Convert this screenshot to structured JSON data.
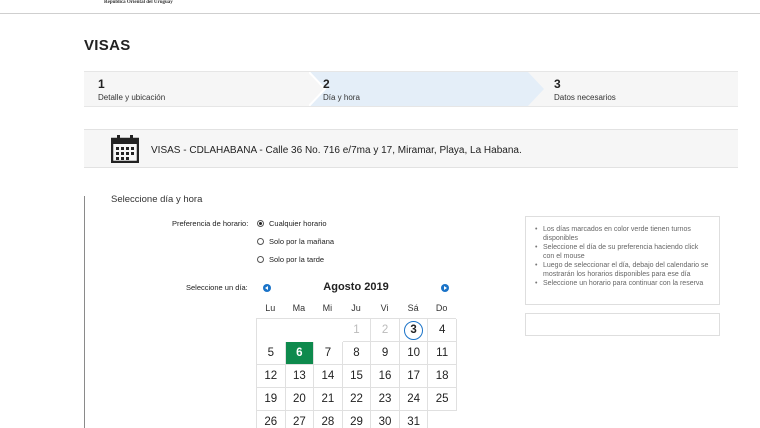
{
  "header": {
    "country": "República Oriental del Uruguay"
  },
  "page": {
    "title": "VISAS"
  },
  "steps": [
    {
      "num": "1",
      "label": "Detalle y ubicación"
    },
    {
      "num": "2",
      "label": "Día y hora"
    },
    {
      "num": "3",
      "label": "Datos necesarios"
    }
  ],
  "location": {
    "text": "VISAS - CDLAHABANA - Calle 36 No. 716 e/7ma y 17, Miramar, Playa, La Habana.",
    "icon": "calendar-icon"
  },
  "form": {
    "section_title": "Seleccione día y hora",
    "pref_label": "Preferencia de horario:",
    "options": [
      "Cualquier horario",
      "Solo por la mañana",
      "Solo por la tarde"
    ],
    "selected_option": "Cualquier horario",
    "day_label": "Seleccione un día:"
  },
  "calendar": {
    "month": "Agosto 2019",
    "weekdays": [
      "Lu",
      "Ma",
      "Mi",
      "Ju",
      "Vi",
      "Sá",
      "Do"
    ],
    "rows": [
      [
        "",
        "",
        "",
        "1",
        "2",
        "3",
        "4"
      ],
      [
        "5",
        "6",
        "7",
        "8",
        "9",
        "10",
        "11"
      ],
      [
        "12",
        "13",
        "14",
        "15",
        "16",
        "17",
        "18"
      ],
      [
        "19",
        "20",
        "21",
        "22",
        "23",
        "24",
        "25"
      ],
      [
        "26",
        "27",
        "28",
        "29",
        "30",
        "31",
        ""
      ]
    ],
    "disabled_days": [
      "1",
      "2"
    ],
    "today": "3",
    "available_days": [
      "6"
    ],
    "available_color": "#0e8a4d",
    "today_color": "#1a73c8"
  },
  "info": {
    "items": [
      "Los días marcados en color verde tienen turnos disponibles",
      "Seleccione el día de su preferencia haciendo click con el mouse",
      "Luego de seleccionar el día, debajo del calendario se mostrarán los horarios disponibles para ese día",
      "Seleccione un horario para continuar con la reserva"
    ]
  }
}
